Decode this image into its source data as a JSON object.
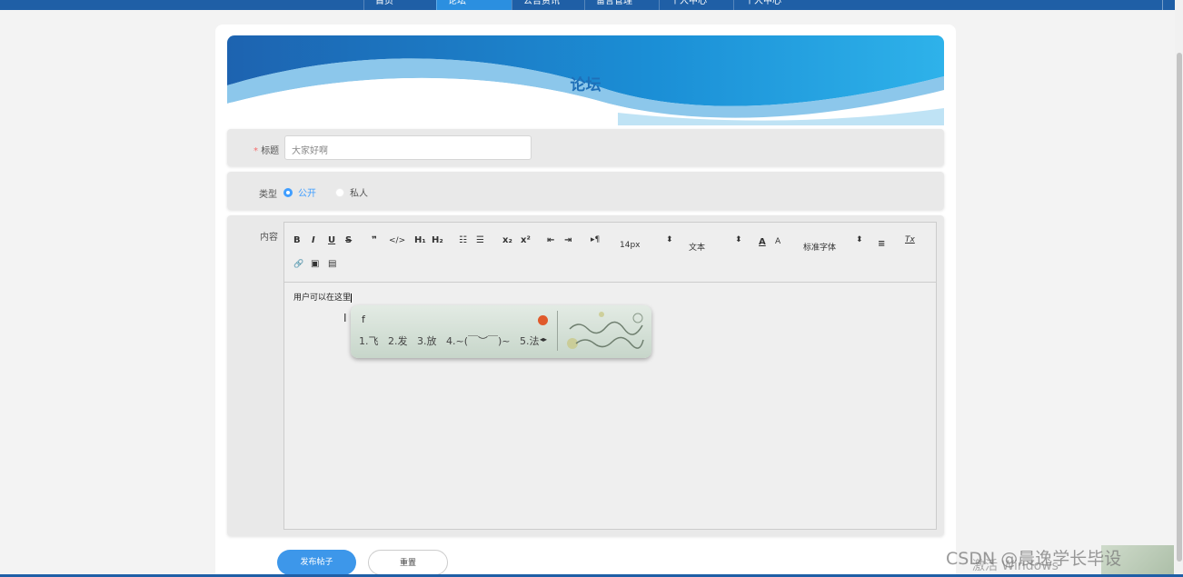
{
  "nav": {
    "tabs": [
      "首页",
      "论坛",
      "公告资讯",
      "留言管理",
      "个人中心",
      "个人中心"
    ]
  },
  "banner": {
    "title": "论坛"
  },
  "form": {
    "title_label": "标题",
    "title_required_mark": "*",
    "title_value": "大家好啊",
    "type_label": "类型",
    "type_options": [
      "公开",
      "私人"
    ],
    "type_selected": "公开",
    "content_label": "内容",
    "content_text": "用户可以在这里"
  },
  "toolbar": {
    "bold": "B",
    "italic": "I",
    "underline": "U",
    "strike": "S",
    "quote": "❞",
    "code": "</>",
    "h1": "H₁",
    "h2": "H₂",
    "ol": "☷",
    "ul": "☰",
    "sub": "x₂",
    "sup": "x²",
    "outdent": "⇤",
    "indent": "⇥",
    "direction": "▸¶",
    "size": "14px",
    "header": "文本",
    "color": "A",
    "background": "A",
    "font": "标准字体",
    "align": "≡",
    "clean": "Tx",
    "link": "🔗",
    "image": "▣",
    "video": "▤"
  },
  "ime": {
    "typed": "f",
    "candidates": [
      "1.飞",
      "2.发",
      "3.放",
      "4.~(￣︶￣)~",
      "5.法"
    ]
  },
  "buttons": {
    "submit": "发布帖子",
    "reset": "重置"
  },
  "watermark": {
    "text": "CSDN @晨逸学长毕设",
    "activate": "激活 Windows"
  },
  "colors": {
    "nav": "#1f5fa6",
    "accent": "#409eff",
    "primary_button": "#3d97ea"
  }
}
